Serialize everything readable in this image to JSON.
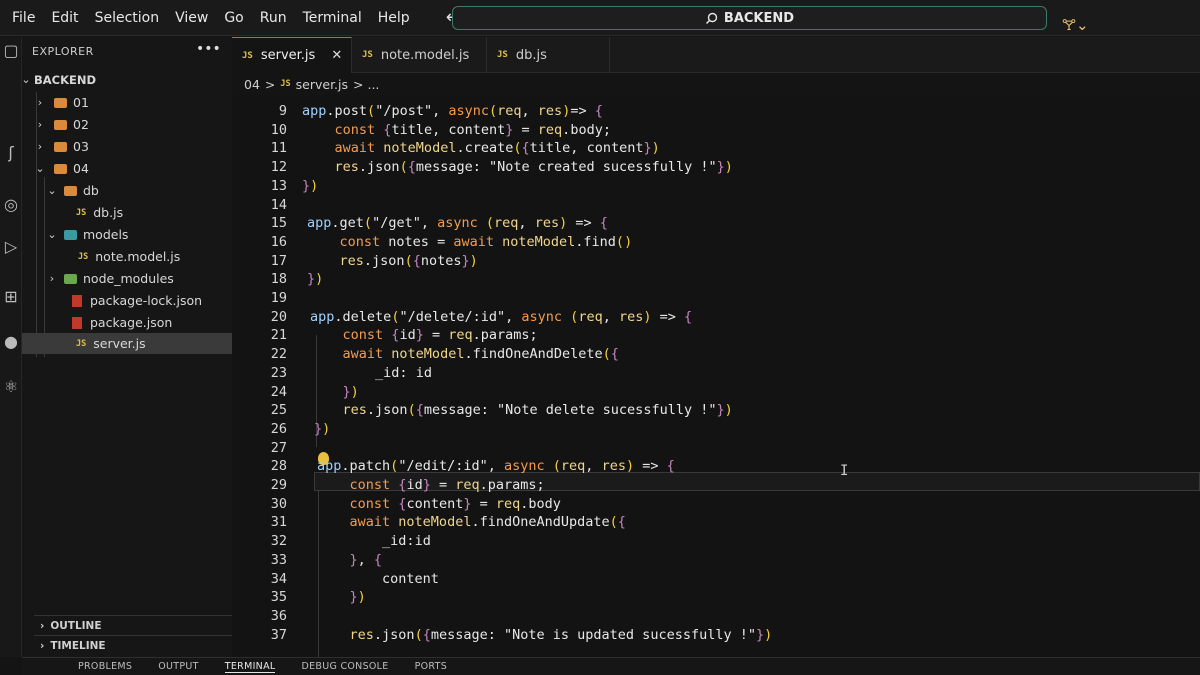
{
  "menu": [
    "File",
    "Edit",
    "Selection",
    "View",
    "Go",
    "Run",
    "Terminal",
    "Help"
  ],
  "search": {
    "label": "BACKEND",
    "icon": "search-icon"
  },
  "explorer": {
    "title": "EXPLORER",
    "more": "•••",
    "root": "BACKEND",
    "items": [
      {
        "label": "01",
        "kind": "folder"
      },
      {
        "label": "02",
        "kind": "folder"
      },
      {
        "label": "03",
        "kind": "folder"
      },
      {
        "label": "04",
        "kind": "folder-open"
      },
      {
        "label": "db",
        "kind": "folder-open"
      },
      {
        "label": "db.js",
        "kind": "js"
      },
      {
        "label": "models",
        "kind": "folder-open"
      },
      {
        "label": "note.model.js",
        "kind": "js"
      },
      {
        "label": "node_modules",
        "kind": "folder"
      },
      {
        "label": "package-lock.json",
        "kind": "json"
      },
      {
        "label": "package.json",
        "kind": "json"
      },
      {
        "label": "server.js",
        "kind": "js",
        "selected": true
      }
    ],
    "outline": "OUTLINE",
    "timeline": "TIMELINE"
  },
  "tabs": [
    {
      "label": "server.js",
      "badge": "JS",
      "active": true,
      "close": "✕"
    },
    {
      "label": "note.model.js",
      "badge": "JS",
      "active": false
    },
    {
      "label": "db.js",
      "badge": "JS",
      "active": false
    }
  ],
  "breadcrumb": {
    "folder": "04",
    "sep": ">",
    "badge": "JS",
    "file": "server.js",
    "tail": "> ..."
  },
  "editor": {
    "lines": [
      9,
      10,
      11,
      12,
      13,
      14,
      15,
      16,
      17,
      18,
      19,
      20,
      21,
      22,
      23,
      24,
      25,
      26,
      27,
      28,
      29,
      30,
      31,
      32,
      33,
      34,
      35,
      36,
      37
    ],
    "code": [
      "app.post(\"/post\", async(req, res)=> {",
      "    const {title, content} = req.body;",
      "    await noteModel.create({title, content})",
      "    res.json({message: \"Note created sucessfully !\"})",
      "})",
      "",
      "app.get(\"/get\", async (req, res) => {",
      "    const notes = await noteModel.find()",
      "    res.json({notes})",
      "})",
      "",
      "app.delete(\"/delete/:id\", async (req, res) => {",
      "    const {id} = req.params;",
      "    await noteModel.findOneAndDelete({",
      "        _id: id",
      "    })",
      "    res.json({message: \"Note delete sucessfully !\"})",
      "})",
      "",
      "app.patch(\"/edit/:id\", async (req, res) => {",
      "    const {id} = req.params;",
      "    const {content} = req.body",
      "    await noteModel.findOneAndUpdate({",
      "        _id:id",
      "    }, {",
      "        content",
      "    })",
      "",
      "    res.json({message: \"Note is updated sucessfully !\"})"
    ]
  },
  "panel": {
    "tabs": [
      "PROBLEMS",
      "OUTPUT",
      "TERMINAL",
      "DEBUG CONSOLE",
      "PORTS"
    ],
    "active": "TERMINAL"
  }
}
